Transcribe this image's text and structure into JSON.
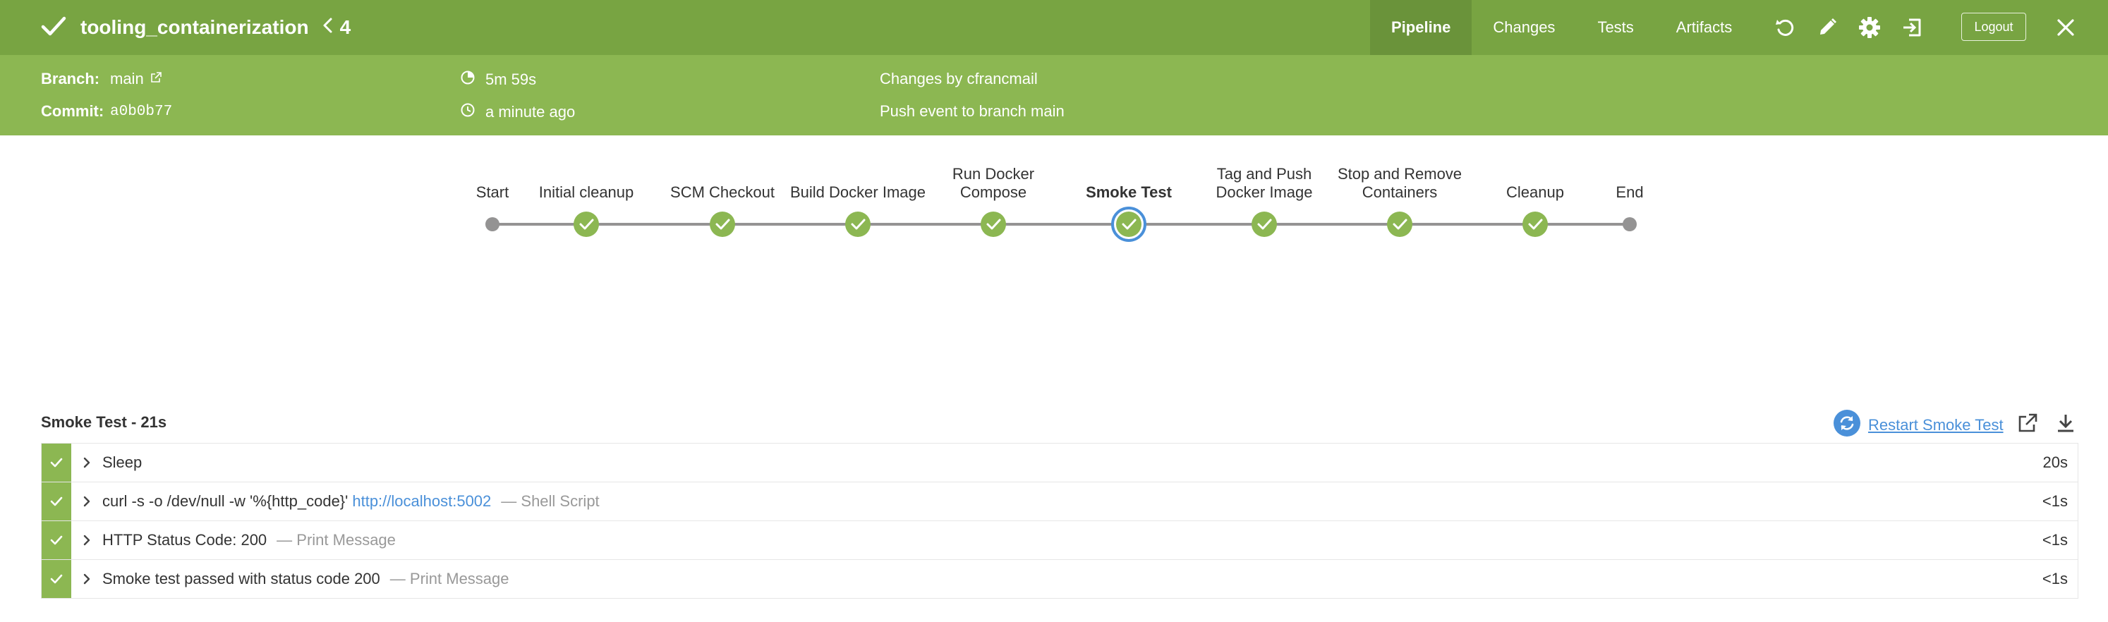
{
  "header": {
    "pipeline_name": "tooling_containerization",
    "run_number": "4",
    "nav": [
      {
        "label": "Pipeline",
        "active": true
      },
      {
        "label": "Changes",
        "active": false
      },
      {
        "label": "Tests",
        "active": false
      },
      {
        "label": "Artifacts",
        "active": false
      }
    ],
    "icons": [
      "replay-icon",
      "edit-icon",
      "settings-icon",
      "exit-icon"
    ],
    "logout_label": "Logout",
    "colors": {
      "bar": "#78a442",
      "bar_active": "#6a933a",
      "info": "#8cb752"
    }
  },
  "run_info": {
    "branch_label": "Branch:",
    "branch_value": "main",
    "commit_label": "Commit:",
    "commit_value": "a0b0b77",
    "duration": "5m 59s",
    "started": "a minute ago",
    "changes": "Changes by cfrancmail",
    "cause": "Push event to branch main"
  },
  "stages": [
    {
      "label": "Start",
      "type": "start"
    },
    {
      "label": "Initial cleanup",
      "type": "success"
    },
    {
      "label": "SCM Checkout",
      "type": "success"
    },
    {
      "label": "Build Docker Image",
      "type": "success"
    },
    {
      "label": "Run Docker Compose",
      "type": "success"
    },
    {
      "label": "Smoke Test",
      "type": "success",
      "selected": true
    },
    {
      "label": "Tag and Push Docker Image",
      "type": "success"
    },
    {
      "label": "Stop and Remove Containers",
      "type": "success"
    },
    {
      "label": "Cleanup",
      "type": "success"
    },
    {
      "label": "End",
      "type": "end"
    }
  ],
  "steps_panel": {
    "title": "Smoke Test - 21s",
    "restart_label": "Restart Smoke Test",
    "steps": [
      {
        "title": "Sleep",
        "link": "",
        "type": "",
        "duration": "20s"
      },
      {
        "title": "curl -s -o /dev/null -w '%{http_code}'",
        "link": "http://localhost:5002",
        "type": "— Shell Script",
        "duration": "<1s"
      },
      {
        "title": "HTTP Status Code: 200",
        "link": "",
        "type": "— Print Message",
        "duration": "<1s"
      },
      {
        "title": "Smoke test passed with status code 200",
        "link": "",
        "type": "— Print Message",
        "duration": "<1s"
      }
    ]
  }
}
